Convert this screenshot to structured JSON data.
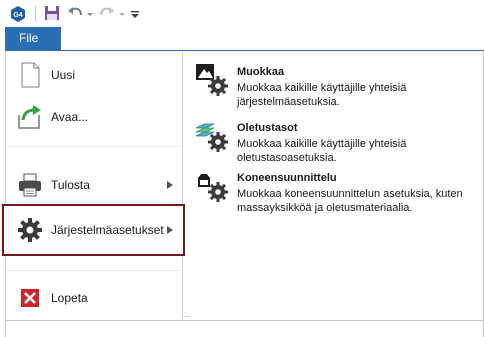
{
  "toolbar": {
    "app_icon": "g4-app-icon",
    "app_icon_text": "G4",
    "buttons": [
      "save-icon",
      "undo-icon",
      "redo-icon",
      "customize-icon"
    ]
  },
  "ribbon": {
    "file_tab_label": "File"
  },
  "backstage": {
    "menu": [
      {
        "label": "Uusi",
        "icon": "new-document-icon"
      },
      {
        "label": "Avaa...",
        "icon": "open-icon"
      },
      {
        "label": "Tulosta",
        "icon": "printer-icon",
        "has_submenu": true
      },
      {
        "label": "Järjestelmäasetukset",
        "icon": "gear-icon",
        "has_submenu": true,
        "selected": true
      },
      {
        "label": "Lopeta",
        "icon": "exit-icon"
      }
    ],
    "submenu": [
      {
        "title": "Muokkaa",
        "description": "Muokkaa kaikille käyttäjille yhteisiä järjestelmäasetuksia.",
        "icon": "edit-settings-icon"
      },
      {
        "title": "Oletustasot",
        "description": "Muokkaa kaikille käyttäjille yhteisiä oletustasoasetuksia.",
        "icon": "layers-settings-icon"
      },
      {
        "title": "Koneensuunnittelu",
        "description": "Muokkaa koneensuunnittelun asetuksia, kuten massayksikköä ja oletusmateriaalia.",
        "icon": "machine-design-settings-icon"
      }
    ]
  },
  "colors": {
    "accent": "#2a6fb6",
    "selection_border": "#7a1620",
    "exit_red": "#d1232a"
  }
}
